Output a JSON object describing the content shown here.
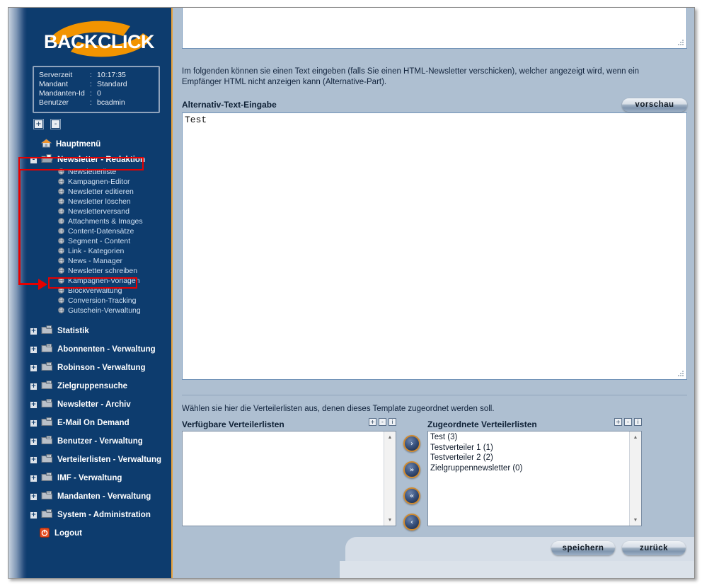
{
  "brand": {
    "name": "BACKCLICK"
  },
  "server_info": {
    "rows": [
      {
        "key": "Serverzeit",
        "sep": ":",
        "value": "10:17:35"
      },
      {
        "key": "Mandant",
        "sep": ":",
        "value": "Standard"
      },
      {
        "key": "Mandanten-Id",
        "sep": ":",
        "value": "0"
      },
      {
        "key": "Benutzer",
        "sep": ":",
        "value": "bcadmin"
      }
    ]
  },
  "tree_controls": {
    "expand_all": "+",
    "collapse_all": "-"
  },
  "sidebar": {
    "home": {
      "label": "Hauptmenü",
      "icon": "home-icon"
    },
    "expanded_group": {
      "label": "Newsletter - Redaktion",
      "toggle": "-",
      "icon": "folder-open-icon",
      "items": [
        "Newsletterliste",
        "Kampagnen-Editor",
        "Newsletter editieren",
        "Newsletter löschen",
        "Newsletterversand",
        "Attachments & Images",
        "Content-Datensätze",
        "Segment - Content",
        "Link - Kategorien",
        "News - Manager",
        "Newsletter schreiben",
        "Kampagnen-Vorlagen",
        "Blockverwaltung",
        "Conversion-Tracking",
        "Gutschein-Verwaltung"
      ]
    },
    "groups": [
      {
        "label": "Statistik",
        "toggle": "+",
        "icon": "folder-icon"
      },
      {
        "label": "Abonnenten - Verwaltung",
        "toggle": "+",
        "icon": "folder-icon"
      },
      {
        "label": "Robinson - Verwaltung",
        "toggle": "+",
        "icon": "folder-icon"
      },
      {
        "label": "Zielgruppensuche",
        "toggle": "+",
        "icon": "folder-icon"
      },
      {
        "label": "Newsletter - Archiv",
        "toggle": "+",
        "icon": "folder-icon"
      },
      {
        "label": "E-Mail On Demand",
        "toggle": "+",
        "icon": "folder-icon"
      },
      {
        "label": "Benutzer - Verwaltung",
        "toggle": "+",
        "icon": "folder-icon"
      },
      {
        "label": "Verteilerlisten - Verwaltung",
        "toggle": "+",
        "icon": "folder-icon"
      },
      {
        "label": "IMF - Verwaltung",
        "toggle": "+",
        "icon": "folder-icon"
      },
      {
        "label": "Mandanten - Verwaltung",
        "toggle": "+",
        "icon": "folder-icon"
      },
      {
        "label": "System - Administration",
        "toggle": "+",
        "icon": "folder-icon"
      }
    ],
    "logout": {
      "label": "Logout",
      "icon": "power-icon"
    }
  },
  "main": {
    "top_textarea_value": "",
    "description": "Im folgenden können sie einen Text eingeben (falls Sie einen HTML-Newsletter verschicken), welcher angezeigt wird, wenn ein Empfänger HTML nicht anzeigen kann (Alternative-Part).",
    "alt_text_label": "Alternativ-Text-Eingabe",
    "preview_button": "vorschau",
    "alt_text_value": "Test",
    "assign_description": "Wählen sie hier die Verteilerlisten aus, denen dieses Template zugeordnet werden soll.",
    "available": {
      "title": "Verfügbare Verteilerlisten",
      "minis": [
        "+",
        "-",
        "i"
      ],
      "items": []
    },
    "assigned": {
      "title": "Zugeordnete Verteilerlisten",
      "minis": [
        "+",
        "-",
        "i"
      ],
      "items": [
        "Test (3)",
        "Testverteiler 1 (1)",
        "Testverteiler 2 (2)",
        "Zielgruppennewsletter (0)"
      ]
    },
    "transfer_buttons": [
      {
        "name": "move-right-one",
        "glyph": "›"
      },
      {
        "name": "move-right-all",
        "glyph": "»"
      },
      {
        "name": "move-left-all",
        "glyph": "«"
      },
      {
        "name": "move-left-one",
        "glyph": "‹"
      }
    ],
    "footer": {
      "save": "speichern",
      "back": "zurück"
    }
  },
  "colors": {
    "sidebar_bg": "#0d3c6e",
    "accent_orange": "#e8a13a",
    "content_bg": "#aebfd1",
    "annotation_red": "#e60000"
  }
}
